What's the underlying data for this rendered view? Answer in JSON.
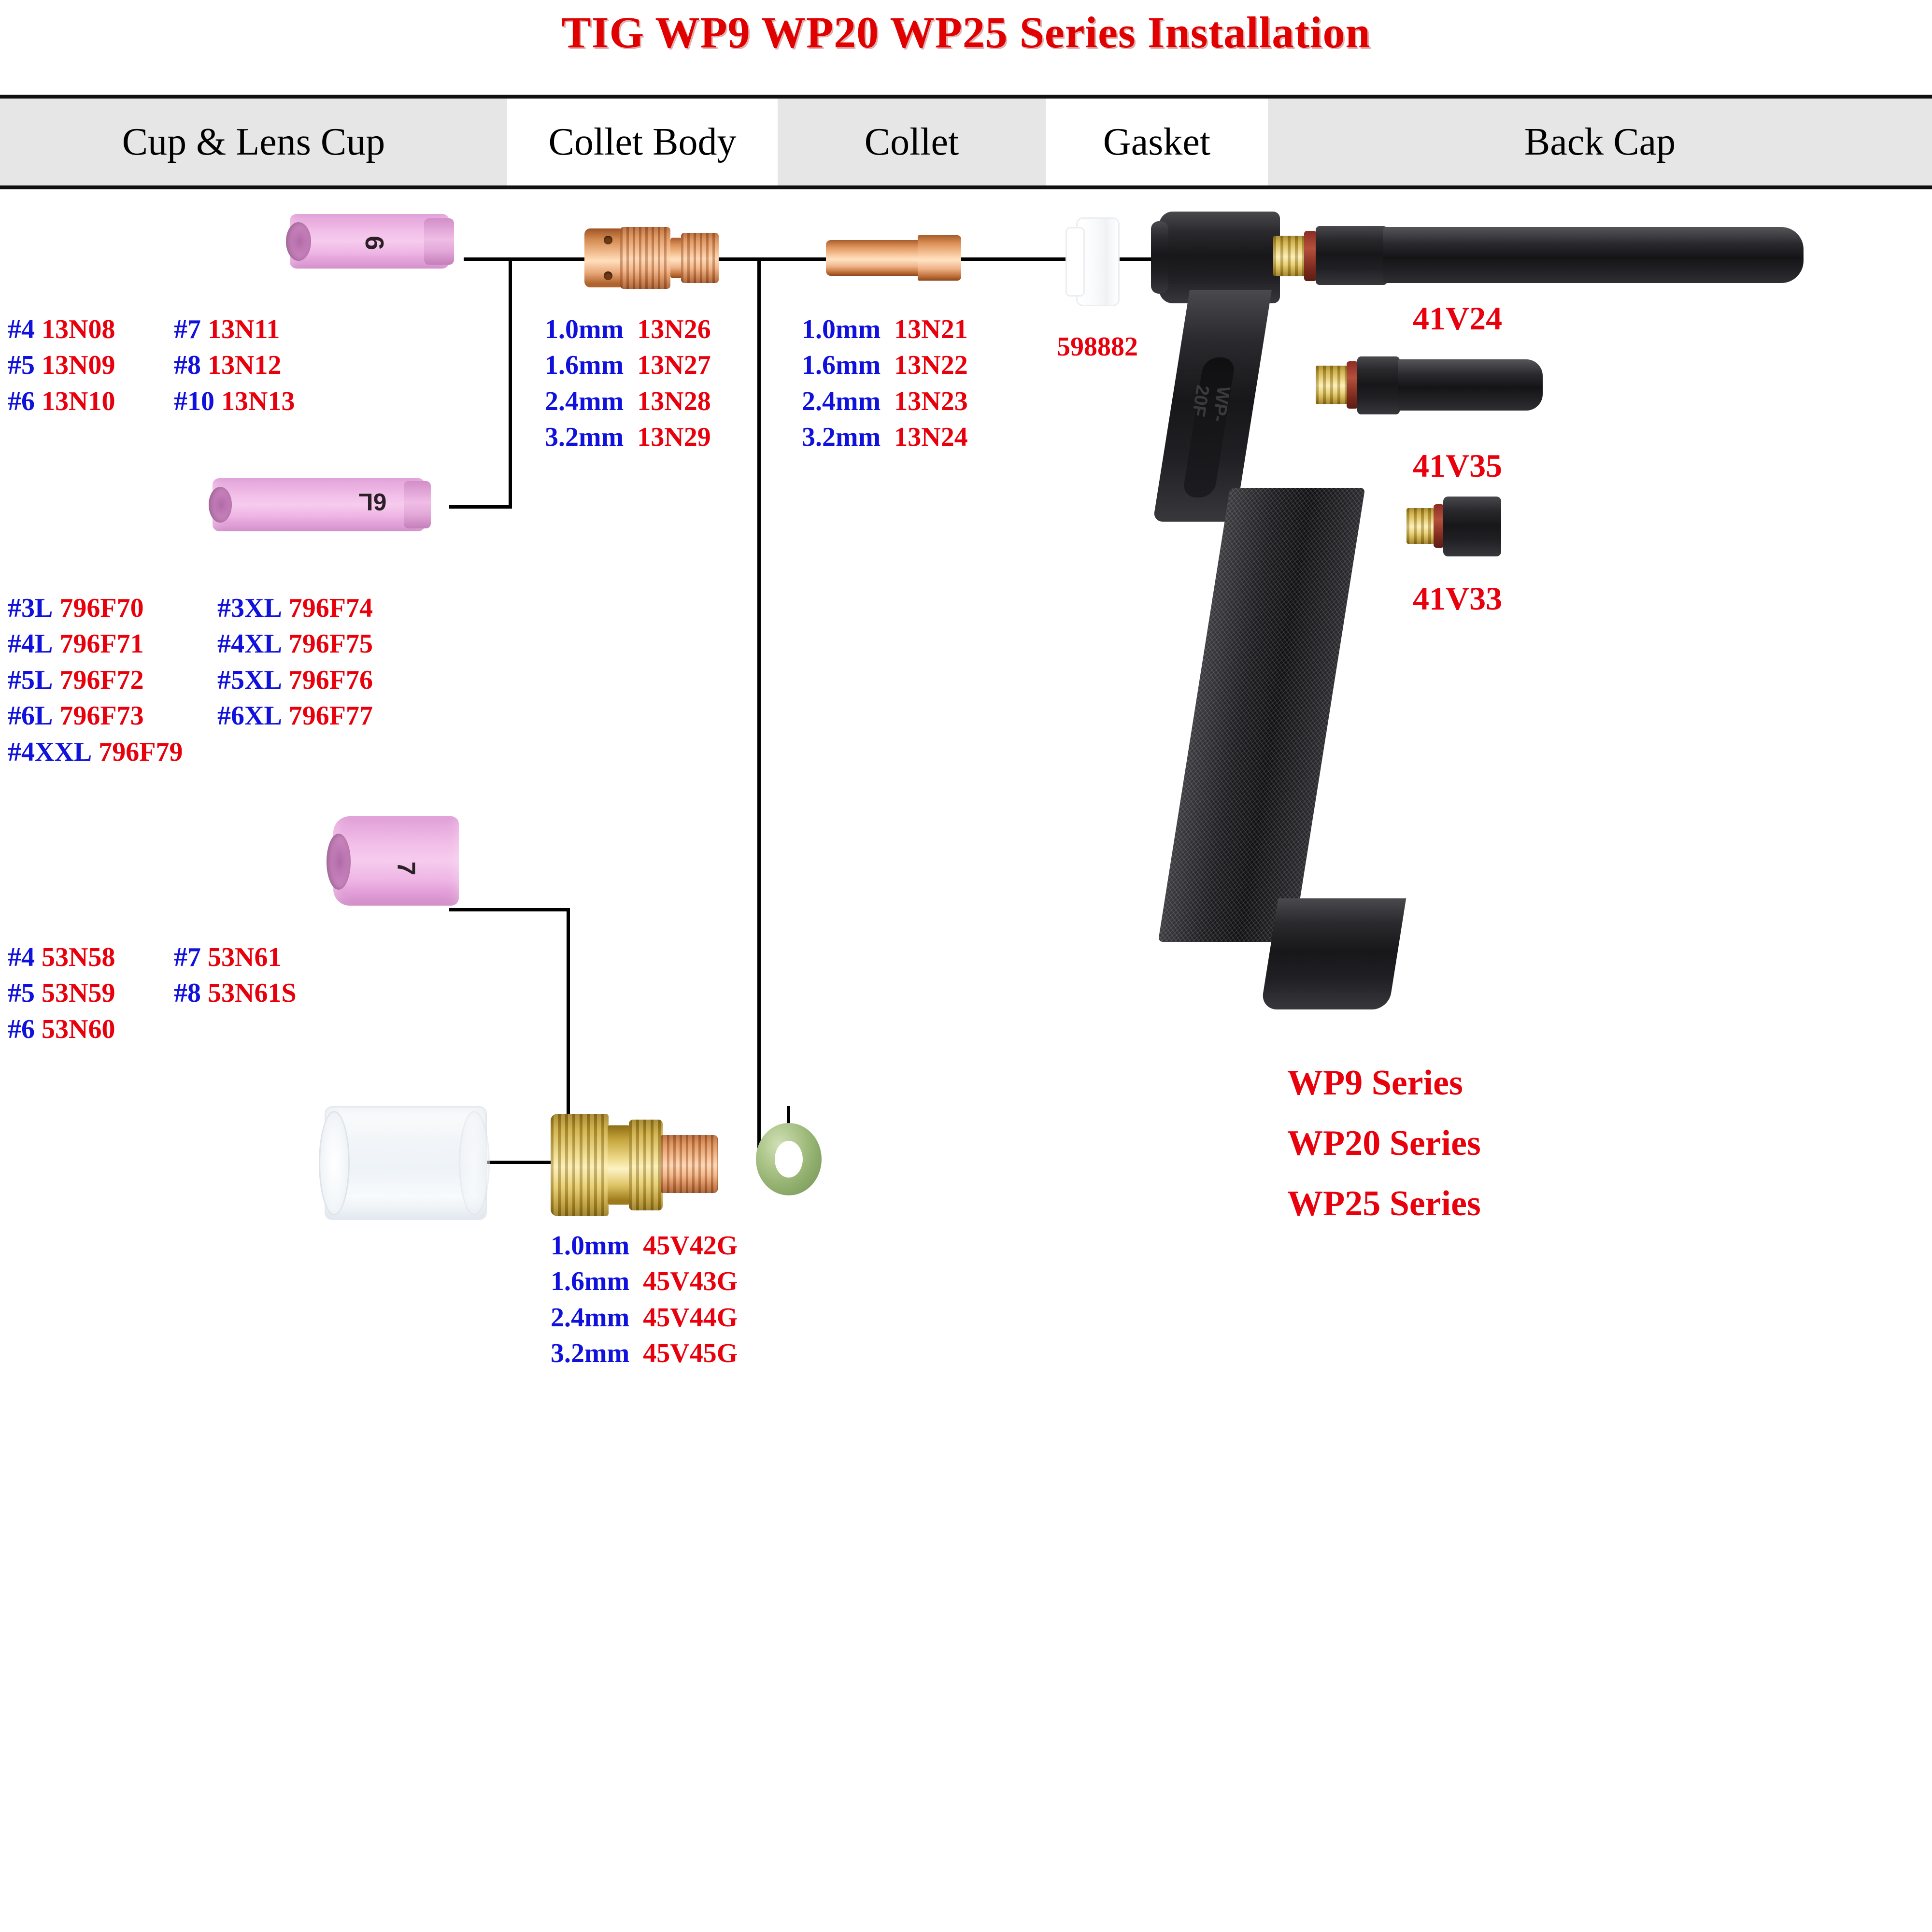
{
  "title": "TIG WP9 WP20 WP25 Series Installation",
  "header": {
    "columns": [
      {
        "label": "Cup & Lens Cup",
        "shaded": true
      },
      {
        "label": "Collet Body",
        "shaded": false
      },
      {
        "label": "Collet",
        "shaded": true
      },
      {
        "label": "Gasket",
        "shaded": false
      },
      {
        "label": "Back Cap",
        "shaded": true
      }
    ]
  },
  "cup_standard": {
    "cup_marking": "6",
    "rows": [
      {
        "size": "#4",
        "part": "13N08",
        "size2": "#7",
        "part2": "13N11"
      },
      {
        "size": "#5",
        "part": "13N09",
        "size2": "#8",
        "part2": "13N12"
      },
      {
        "size": "#6",
        "part": "13N10",
        "size2": "#10",
        "part2": "13N13"
      }
    ]
  },
  "cup_long": {
    "cup_marking": "6L",
    "rows": [
      {
        "size": "#3L",
        "part": "796F70",
        "size2": "#3XL",
        "part2": "796F74"
      },
      {
        "size": "#4L",
        "part": "796F71",
        "size2": "#4XL",
        "part2": "796F75"
      },
      {
        "size": "#5L",
        "part": "796F72",
        "size2": "#5XL",
        "part2": "796F76"
      },
      {
        "size": "#6L",
        "part": "796F73",
        "size2": "#6XL",
        "part2": "796F77"
      },
      {
        "size": "#4XXL",
        "part": "796F79",
        "size2": "",
        "part2": ""
      }
    ]
  },
  "cup_gaslens": {
    "cup_marking": "7",
    "rows": [
      {
        "size": "#4",
        "part": "53N58",
        "size2": "#7",
        "part2": "53N61"
      },
      {
        "size": "#5",
        "part": "53N59",
        "size2": "#8",
        "part2": "53N61S"
      },
      {
        "size": "#6",
        "part": "53N60",
        "size2": "",
        "part2": ""
      }
    ]
  },
  "collet_body": {
    "rows": [
      {
        "size": "1.0mm",
        "part": "13N26"
      },
      {
        "size": "1.6mm",
        "part": "13N27"
      },
      {
        "size": "2.4mm",
        "part": "13N28"
      },
      {
        "size": "3.2mm",
        "part": "13N29"
      }
    ]
  },
  "collet": {
    "rows": [
      {
        "size": "1.0mm",
        "part": "13N21"
      },
      {
        "size": "1.6mm",
        "part": "13N22"
      },
      {
        "size": "2.4mm",
        "part": "13N23"
      },
      {
        "size": "3.2mm",
        "part": "13N24"
      }
    ]
  },
  "gas_lens": {
    "rows": [
      {
        "size": "1.0mm",
        "part": "45V42G"
      },
      {
        "size": "1.6mm",
        "part": "45V43G"
      },
      {
        "size": "2.4mm",
        "part": "45V44G"
      },
      {
        "size": "3.2mm",
        "part": "45V45G"
      }
    ]
  },
  "gasket": {
    "part": "598882"
  },
  "back_caps": [
    {
      "part": "41V24"
    },
    {
      "part": "41V35"
    },
    {
      "part": "41V33"
    }
  ],
  "torch": {
    "molded_text": "WP-20F",
    "series": [
      "WP9 Series",
      "WP20 Series",
      "WP25 Series"
    ]
  },
  "colors": {
    "title_red": "#e00000",
    "part_red": "#e8000c",
    "size_blue": "#1111dd",
    "header_shade": "#e6e6e6",
    "line_black": "#000000",
    "ceramic_pink": "#f2bfe9",
    "copper": "#f6c49a",
    "brass": "#efdb90",
    "oring_green": "#a8c185"
  }
}
